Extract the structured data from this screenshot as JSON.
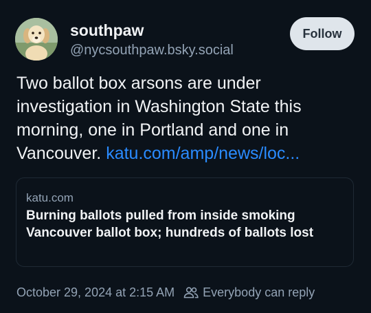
{
  "author": {
    "display_name": "southpaw",
    "handle": "@nycsouthpaw.bsky.social",
    "avatar_icon": "golden-retriever-puppy-avatar"
  },
  "follow_button": {
    "label": "Follow"
  },
  "post": {
    "text": "Two ballot box arsons are under investigation in Washington State this morning, one in Portland and one in Vancouver.",
    "link_text": "katu.com/amp/news/loc..."
  },
  "link_card": {
    "domain": "katu.com",
    "title": "Burning ballots pulled from inside smoking Vancouver ballot box; hundreds of ballots lost"
  },
  "footer": {
    "timestamp": "October 29, 2024 at 2:15 AM",
    "reply_setting": "Everybody can reply",
    "reply_icon": "people-icon"
  },
  "colors": {
    "background": "#0b121a",
    "text": "#f1f3f5",
    "muted": "#93a3b5",
    "link": "#2a8bff",
    "button_bg": "#dfe5eb",
    "button_text": "#27313c",
    "card_border": "#1f2a35"
  }
}
